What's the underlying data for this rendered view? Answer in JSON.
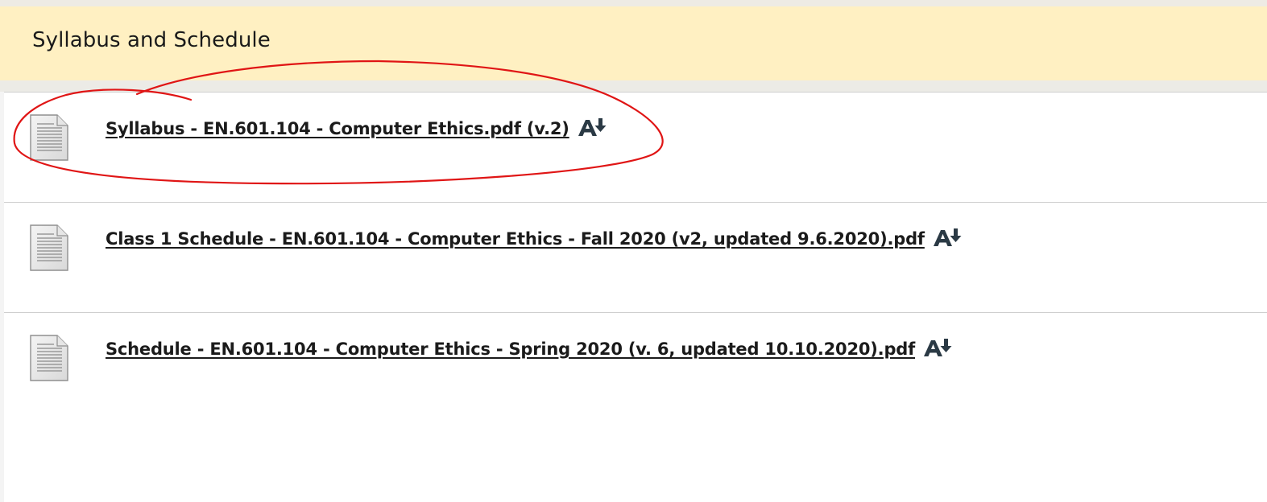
{
  "section": {
    "title": "Syllabus and Schedule"
  },
  "items": [
    {
      "label": "Syllabus - EN.601.104 - Computer Ethics.pdf (v.2)",
      "icon": "document-icon",
      "action_icon": "download-alternate-format-icon"
    },
    {
      "label": "Class 1 Schedule - EN.601.104 - Computer Ethics - Fall 2020 (v2, updated 9.6.2020).pdf",
      "icon": "document-icon",
      "action_icon": "download-alternate-format-icon"
    },
    {
      "label": "Schedule - EN.601.104 - Computer Ethics - Spring 2020 (v. 6, updated 10.10.2020).pdf",
      "icon": "document-icon",
      "action_icon": "download-alternate-format-icon"
    }
  ],
  "colors": {
    "header_background": "#fff0c2",
    "annotation": "#e01515",
    "link_text": "#1b1b1b"
  }
}
